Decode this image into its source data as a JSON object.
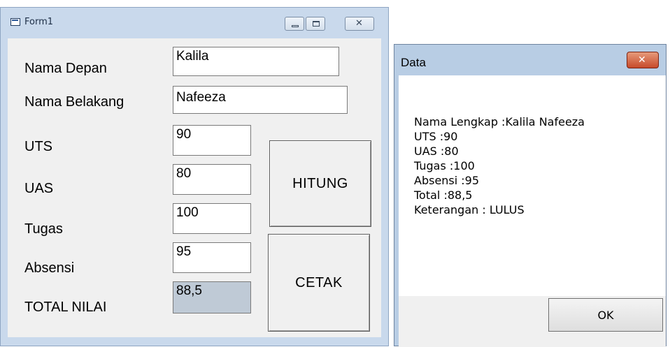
{
  "form1": {
    "title": "Form1",
    "labels": {
      "nama_depan": "Nama Depan",
      "nama_belakang": "Nama Belakang",
      "uts": "UTS",
      "uas": "UAS",
      "tugas": "Tugas",
      "absensi": "Absensi",
      "total_nilai": "TOTAL NILAI"
    },
    "values": {
      "nama_depan": "Kalila",
      "nama_belakang": "Nafeeza",
      "uts": "90",
      "uas": "80",
      "tugas": "100",
      "absensi": "95",
      "total_nilai": "88,5"
    },
    "buttons": {
      "hitung": "HITUNG",
      "cetak": "CETAK"
    },
    "caption_close_glyph": "✕"
  },
  "dialog": {
    "title": "Data",
    "close_glyph": "✕",
    "lines": [
      "Nama Lengkap :Kalila Nafeeza",
      "UTS :90",
      "UAS :80",
      "Tugas :100",
      "Absensi :95",
      "Total :88,5",
      "Keterangan : LULUS"
    ],
    "ok_label": "OK"
  }
}
